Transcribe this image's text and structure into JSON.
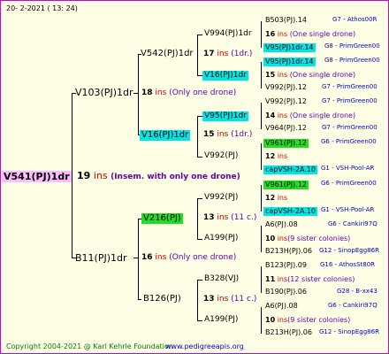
{
  "header": {
    "date": "20-  2-2021  ( 13: 24)"
  },
  "footer": {
    "copyright": "Copyright 2004-2021 @ Karl Kehrle Foundation",
    "website": "www.pedigreeapis.org"
  },
  "colors": {
    "border": "#d000d0",
    "root_bg": "#ffbbff",
    "cyan": "#00e5e5",
    "green": "#22dd22",
    "red": "#cc0000",
    "blue": "#0000cc",
    "purple": "#6600aa"
  },
  "root": {
    "id": "V541(PJ)1dr",
    "count": "19",
    "ins": "ins",
    "note": "(Insem. with only one drone)"
  },
  "g1": [
    {
      "id": "V103(PJ)1dr",
      "count": "18",
      "ins": "ins",
      "note": "(Only one drone)"
    },
    {
      "id": "B11(PJ)1dr",
      "count": "16",
      "ins": "ins",
      "note": "(Only one drone)"
    }
  ],
  "g2": [
    {
      "id": "V542(PJ)1dr",
      "count": "17",
      "ins": "ins",
      "note": "(1dr.)"
    },
    {
      "id": "V16(PJ)1dr",
      "count": "15",
      "ins": "ins",
      "note": "(1dr.)"
    },
    {
      "id": "V216(PJ)",
      "count": "13",
      "ins": "ins",
      "note": "(11 c.)"
    },
    {
      "id": "B126(PJ)",
      "count": "13",
      "ins": "ins",
      "note": "(11 c.)"
    }
  ],
  "g3": [
    {
      "id": "V994(PJ)1dr",
      "count": "16",
      "ins": "ins",
      "note": "(One single drone)"
    },
    {
      "id": "V16(PJ)1dr",
      "count": "15",
      "ins": "ins",
      "note": "(One single drone)"
    },
    {
      "id": "V95(PJ)1dr",
      "count": "14",
      "ins": "ins",
      "note": "(One single drone)"
    },
    {
      "id": "V992(PJ)",
      "count": "12",
      "ins": "ins",
      "note": ""
    },
    {
      "id": "V992(PJ)",
      "count": "12",
      "ins": "ins",
      "note": ""
    },
    {
      "id": "A199(PJ)",
      "count": "10",
      "ins": "ins",
      "note": "(9 sister colonies)"
    },
    {
      "id": "B328(VJ)",
      "count": "11",
      "ins": "ins",
      "note": "(12 sister colonies)"
    },
    {
      "id": "A199(PJ)",
      "count": "10",
      "ins": "ins",
      "note": "(9 sister colonies)"
    }
  ],
  "g4": [
    {
      "id": "B503(PJ).14",
      "src": "G7 - Athos00R"
    },
    {
      "id": "V95(PJ)1dr.14",
      "src": "G8 - PrimGreen00"
    },
    {
      "id": "V95(PJ)1dr.14",
      "src": "G8 - PrimGreen00"
    },
    {
      "id": "V992(PJ).12",
      "src": "G7 - PrimGreen00"
    },
    {
      "id": "V992(PJ).12",
      "src": "G7 - PrimGreen00"
    },
    {
      "id": "V964(PJ).12",
      "src": "G7 - PrimGreen00"
    },
    {
      "id": "V961(PJ).12",
      "src": "G6 - PrimGreen00"
    },
    {
      "id": "capVSH-2A.10",
      "src": "G1 - VSH-Pool-AR"
    },
    {
      "id": "V961(PJ).12",
      "src": "G6 - PrimGreen00"
    },
    {
      "id": "capVSH-2A.10",
      "src": "G1 - VSH-Pool-AR"
    },
    {
      "id": "A6(PJ).08",
      "src": "G6 - Cankiri97Q"
    },
    {
      "id": "B213H(PJ).06",
      "src": "G12 - SinopEgg86R"
    },
    {
      "id": "B123(PJ).09",
      "src": "G16 - AthosSt80R"
    },
    {
      "id": "B190(PJ).06",
      "src": "G28 - B-xx43"
    },
    {
      "id": "A6(PJ).08",
      "src": "G6 - Cankiri97Q"
    },
    {
      "id": "B213H(PJ).06",
      "src": "G12 - SinopEgg86R"
    }
  ]
}
